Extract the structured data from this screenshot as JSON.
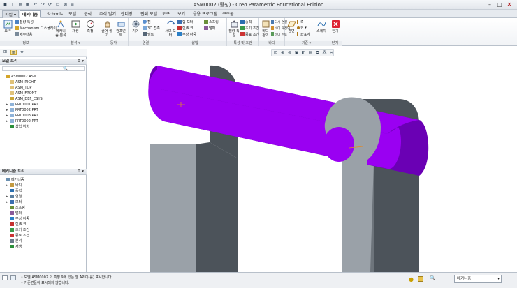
{
  "window": {
    "title": "ASM0002 (활성) - Creo Parametric Educational Edition"
  },
  "tabs": [
    {
      "label": "파일 ▾",
      "key": "file"
    },
    {
      "label": "메커니즘",
      "key": "active"
    },
    {
      "label": "Schools"
    },
    {
      "label": "모델"
    },
    {
      "label": "분석"
    },
    {
      "label": "주석 달기"
    },
    {
      "label": "렌더링"
    },
    {
      "label": "인쇄 모델"
    },
    {
      "label": "도구"
    },
    {
      "label": "보기"
    },
    {
      "label": "응용 프로그램"
    },
    {
      "label": "구조물"
    }
  ],
  "ribbon": {
    "info": {
      "label": "정보",
      "summary": "요약",
      "detail": "질량 특성",
      "mech_disp": "Mechanism 디스플레이",
      "detail_info": "세부내용"
    },
    "analysis": {
      "label": "분석 ▾",
      "mech_analysis": "메커니즘 분석",
      "playback": "재생",
      "measure": "측정"
    },
    "motion": {
      "label": "동작",
      "drag": "끌어 놓기",
      "component": "컴포넌트"
    },
    "connect": {
      "label": "연결",
      "gear": "기어",
      "cam": "캠",
      "cam3d": "3D 접촉",
      "belt": "벨트"
    },
    "insert": {
      "label": "삽입",
      "servo": "서보 모터",
      "force_motor": "힘 모터",
      "force_torque": "힘/토크",
      "load": "부상 하중",
      "spring": "스프링",
      "damper": "댐퍼"
    },
    "props": {
      "label": "특성 및 조건",
      "mass": "질량 특성",
      "gravity": "중력",
      "init": "초기 조건",
      "term": "종료 조건"
    },
    "body": {
      "label": "바디",
      "define": "바디 정의",
      "reconnect": "다시 연결",
      "rebody": "바디 재정의",
      "bodytest": "바디 검토"
    },
    "datum": {
      "label": "기준 ▾",
      "plane": "평면",
      "axis": "축",
      "point": "점 ▾",
      "csys": "좌표계",
      "sketch": "스케치"
    },
    "close": {
      "label": "닫기",
      "btn": "닫기"
    }
  },
  "model_tree": {
    "title": "모델 트리",
    "items": [
      {
        "label": "ASM0002.ASM",
        "indent": 0,
        "icon": "asm",
        "exp": ""
      },
      {
        "label": "ASM_RIGHT",
        "indent": 1,
        "icon": "plane",
        "exp": ""
      },
      {
        "label": "ASM_TOP",
        "indent": 1,
        "icon": "plane",
        "exp": ""
      },
      {
        "label": "ASM_FRONT",
        "indent": 1,
        "icon": "plane",
        "exp": ""
      },
      {
        "label": "ASM_DEF_CSYS",
        "indent": 1,
        "icon": "csys",
        "exp": ""
      },
      {
        "label": "PRT0001.PRT",
        "indent": 1,
        "icon": "part",
        "exp": "▸"
      },
      {
        "label": "PRT0002.PRT",
        "indent": 1,
        "icon": "part",
        "exp": "▸"
      },
      {
        "label": "PRT0003.PRT",
        "indent": 1,
        "icon": "part",
        "exp": "▸"
      },
      {
        "label": "PRT0002.PRT",
        "indent": 1,
        "icon": "part",
        "exp": "▸"
      },
      {
        "label": "삽입 위치",
        "indent": 1,
        "icon": "insert",
        "exp": ""
      }
    ]
  },
  "mech_tree": {
    "title": "메커니즘 트리",
    "items": [
      {
        "label": "메커니즘",
        "indent": 0,
        "icon": "mech",
        "exp": ""
      },
      {
        "label": "바디",
        "indent": 1,
        "icon": "body",
        "exp": "▸"
      },
      {
        "label": "중력",
        "indent": 1,
        "icon": "grav",
        "exp": ""
      },
      {
        "label": "연결",
        "indent": 1,
        "icon": "conn",
        "exp": "▸"
      },
      {
        "label": "모터",
        "indent": 1,
        "icon": "motor",
        "exp": "▸"
      },
      {
        "label": "스프링",
        "indent": 1,
        "icon": "spring",
        "exp": ""
      },
      {
        "label": "댐퍼",
        "indent": 1,
        "icon": "damper",
        "exp": ""
      },
      {
        "label": "부상 하중",
        "indent": 1,
        "icon": "load",
        "exp": ""
      },
      {
        "label": "힘/토크",
        "indent": 1,
        "icon": "force",
        "exp": ""
      },
      {
        "label": "초기 조건",
        "indent": 1,
        "icon": "init",
        "exp": ""
      },
      {
        "label": "종료 조건",
        "indent": 1,
        "icon": "term",
        "exp": ""
      },
      {
        "label": "분석",
        "indent": 1,
        "icon": "analysis",
        "exp": ""
      },
      {
        "label": "재생",
        "indent": 1,
        "icon": "play",
        "exp": ""
      }
    ]
  },
  "status": {
    "msg1": "• 모델 ASM0002 의 측정 9에 있는 웹 API이(를) 표시합니다.",
    "msg2": "• 기준면들이 표시되지 않습니다.",
    "filter": "메커니즘"
  },
  "colors": {
    "purple": "#9a00f2",
    "purple_dark": "#6a00b4",
    "gray": "#9aa1a8",
    "gray_dark": "#4c535a",
    "gray_side": "#6d747b"
  }
}
